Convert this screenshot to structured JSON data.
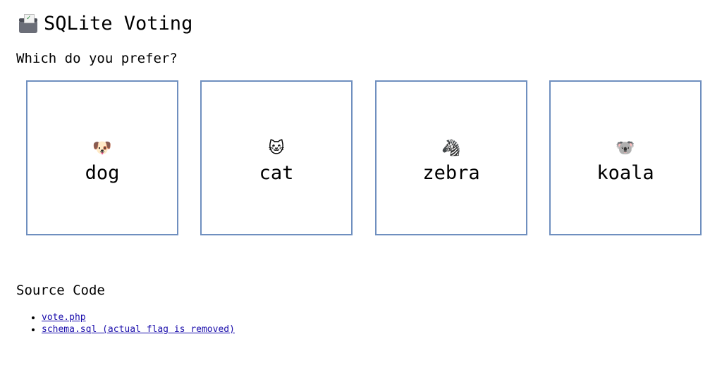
{
  "header": {
    "icon": "ballot-box-icon",
    "title": "SQLite Voting"
  },
  "question": "Which do you prefer?",
  "choices": [
    {
      "emoji": "🐶",
      "icon": "dog-face-icon",
      "label": "dog"
    },
    {
      "emoji": "🐱",
      "icon": "cat-face-icon",
      "label": "cat"
    },
    {
      "emoji": "🦓",
      "icon": "zebra-icon",
      "label": "zebra"
    },
    {
      "emoji": "🐨",
      "icon": "koala-icon",
      "label": "koala"
    }
  ],
  "source": {
    "heading": "Source Code",
    "links": [
      {
        "label": "vote.php"
      },
      {
        "label": "schema.sql (actual flag is removed)"
      }
    ]
  },
  "colors": {
    "card_border": "#6f8fbf",
    "link": "#1a0dab"
  }
}
